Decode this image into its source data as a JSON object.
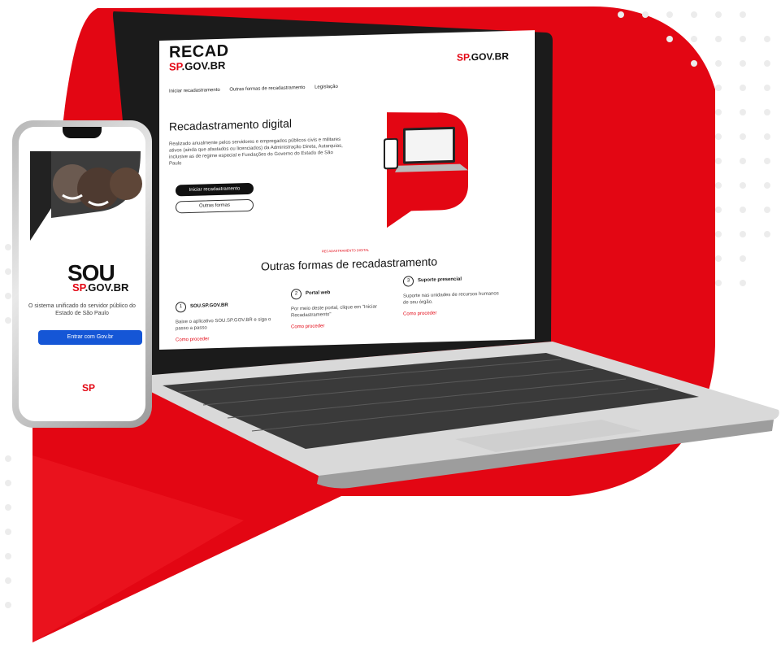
{
  "laptop": {
    "logo_top": "RECAD",
    "logo_bottom_mark": "SP",
    "logo_bottom_text": ".GOV.BR",
    "header_brand_mark": "SP",
    "header_brand_text": ".GOV.BR",
    "nav": [
      "Iniciar recadastramento",
      "Outras formas de recadastramento",
      "Legislação"
    ],
    "hero_title": "Recadastramento digital",
    "hero_text": "Realizado anualmente pelos servidores e empregados públicos civis e militares ativos (ainda que afastados ou licenciados) da Administração Direta, Autarquias, inclusive as de regime especial e Fundações do Governo do Estado de São Paulo",
    "btn_primary": "Iniciar recadastramento",
    "btn_secondary": "Outras formas",
    "section_kicker": "RECADASTRAMENTO DIGITAL",
    "section_title": "Outras formas de recadastramento",
    "cards": [
      {
        "num": "1",
        "title": "SOU.SP.GOV.BR",
        "text": "Baixe o aplicativo SOU.SP.GOV.BR e siga o passo a passo",
        "link": "Como proceder"
      },
      {
        "num": "2",
        "title": "Portal web",
        "text": "Por meio deste portal, clique em \"Iniciar Recadastramento\"",
        "link": "Como proceder"
      },
      {
        "num": "3",
        "title": "Suporte presencial",
        "text": "Suporte nas unidades de recursos humanos de seu órgão.",
        "link": "Como proceder"
      }
    ]
  },
  "phone": {
    "brand_big": "SOU",
    "brand_mark": "SP",
    "brand_text": ".GOV.BR",
    "description": "O sistema unificado do servidor público do Estado de São Paulo",
    "button": "Entrar com Gov.br",
    "footer_logo": "SP"
  },
  "colors": {
    "accent": "#e30613",
    "button_blue": "#1556d6"
  }
}
